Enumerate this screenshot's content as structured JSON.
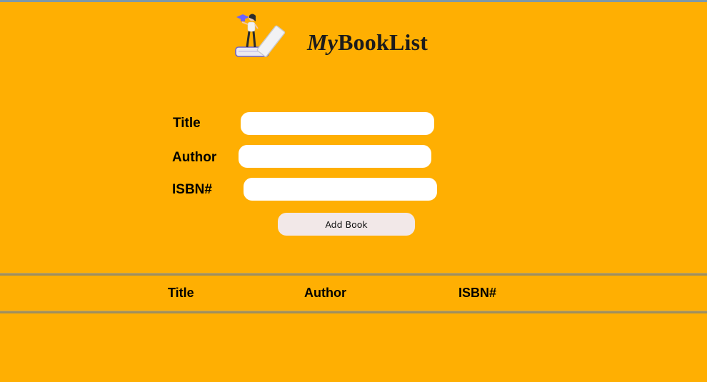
{
  "header": {
    "brand_prefix": "My",
    "brand_suffix": "BookList",
    "logo_icon": "reader-on-books-icon"
  },
  "form": {
    "title_label": "Title",
    "title_value": "",
    "author_label": "Author",
    "author_value": "",
    "isbn_label": "ISBN#",
    "isbn_value": "",
    "submit_label": "Add Book"
  },
  "table": {
    "headers": [
      "Title",
      "Author",
      "ISBN#"
    ],
    "rows": []
  },
  "colors": {
    "background": "#FFAF02",
    "input": "#FFFFFF",
    "button": "#F2E8E8",
    "rule": "#A08F5C"
  }
}
